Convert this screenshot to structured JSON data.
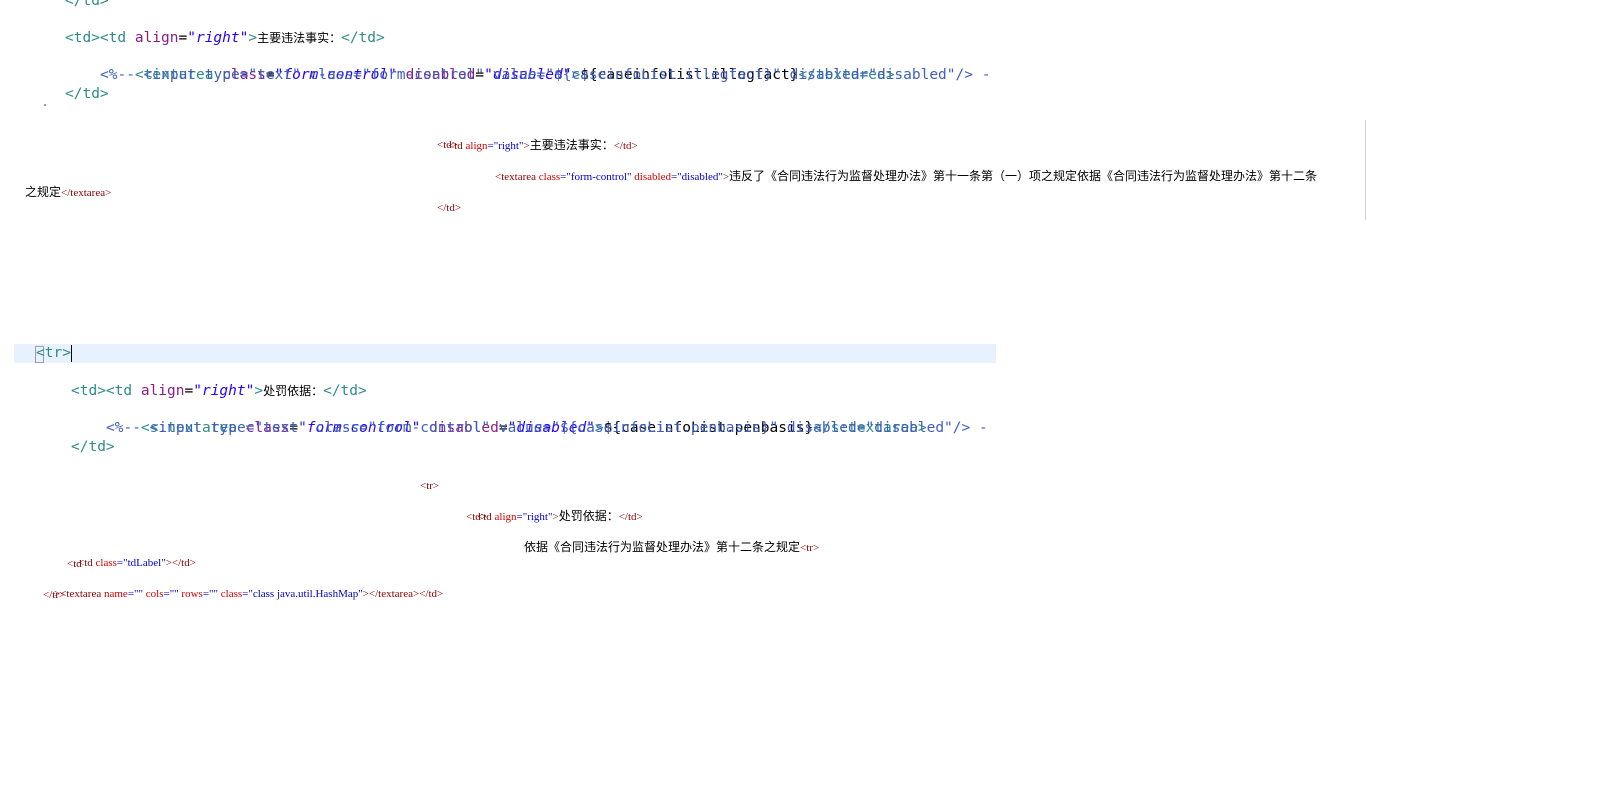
{
  "block1": {
    "line0": "</td>",
    "line1_tag": "<td ",
    "line1_attr": "align",
    "line1_eq": "=",
    "line1_val": "\"right\"",
    "line1_gt": ">",
    "line1_text": "主要违法事实：",
    "line1_close": "</td>",
    "line2": "<td>",
    "line3_tag": "<textarea ",
    "line3_attr1": "class",
    "line3_eq1": "=",
    "line3_val1": "\"form-control\"",
    "line3_attr2": " disabled",
    "line3_eq2": "=",
    "line3_val2": "\"disabled\"",
    "line3_gt": ">",
    "line3_el": "${caseinfoList.illegfact}",
    "line3_close": "</textarea>",
    "line4": "<%-- <input type=\"text\" class=\"form-control\" value=\"${caseinfoList.illegfact}\" disabled=\"disabled\"/> -",
    "line5": "</td>"
  },
  "block2": {
    "l1_a": "<td ",
    "l1_attr": "align",
    "l1_val": "=\"right\"",
    "l1_gt": ">",
    "l1_text": "主要违法事实：",
    "l1_close": "</td>",
    "l2": "<td>",
    "l3_a": "<textarea ",
    "l3_attr1": "class",
    "l3_val1": "=\"form-control\"",
    "l3_attr2": " disabled",
    "l3_val2": "=\"disabled\"",
    "l3_gt": ">",
    "l3_text": "违反了《合同违法行为监督处理办法》第十一条第（一）项之规定依据《合同违法行为监督处理办法》第十二条",
    "l4_text": "之规定",
    "l4_close": "</textarea>",
    "l5": "</td>"
  },
  "block3": {
    "tr": "<tr>",
    "l1_tag": "<td ",
    "l1_attr": "align",
    "l1_eq": "=",
    "l1_val": "\"right\"",
    "l1_gt": ">",
    "l1_text": "处罚依据：",
    "l1_close": "</td>",
    "l2": "<td>",
    "l3_tag": "<s:textarea ",
    "l3_attr1": "class",
    "l3_eq1": "=",
    "l3_val1": "\"form-control\"",
    "l3_attr2": " disabled",
    "l3_eq2": "=",
    "l3_val2": "\"disabled\"",
    "l3_gt": ">",
    "l3_el": "${caseinfoList.penbasis}",
    "l3_close": "</s:textarea>",
    "l4": "<%-- <input type=\"text\" class=\"form-control\" value=\"${caseinfoList.penbasis}\" disabled=\"disabled\"/> -",
    "l5": "</td>"
  },
  "block4": {
    "tr": "<tr>",
    "l1_a": "<td ",
    "l1_attr": "align",
    "l1_val": "=\"right\"",
    "l1_gt": ">",
    "l1_text": "处罚依据：",
    "l1_close": "</td>",
    "l2": "<td>",
    "l3_text": "依据《合同违法行为监督处理办法》第十二条之规定",
    "l3_tr": "<tr>",
    "l4_a": "<td ",
    "l4_attr": "class",
    "l4_val": "=\"tdLabel\"",
    "l4_close": "></td>",
    "l5": "<td",
    "l6_gt": ">",
    "l6_tag": "<textarea ",
    "l6_attr1": "name",
    "l6_val1": "=\"\"",
    "l6_attr2": " cols",
    "l6_val2": "=\"\"",
    "l6_attr3": " rows",
    "l6_val3": "=\"\"",
    "l6_attr4": " class",
    "l6_val4": "=\"class java.util.HashMap\"",
    "l6_close": "></textarea></td>",
    "l7": "</tr>"
  }
}
